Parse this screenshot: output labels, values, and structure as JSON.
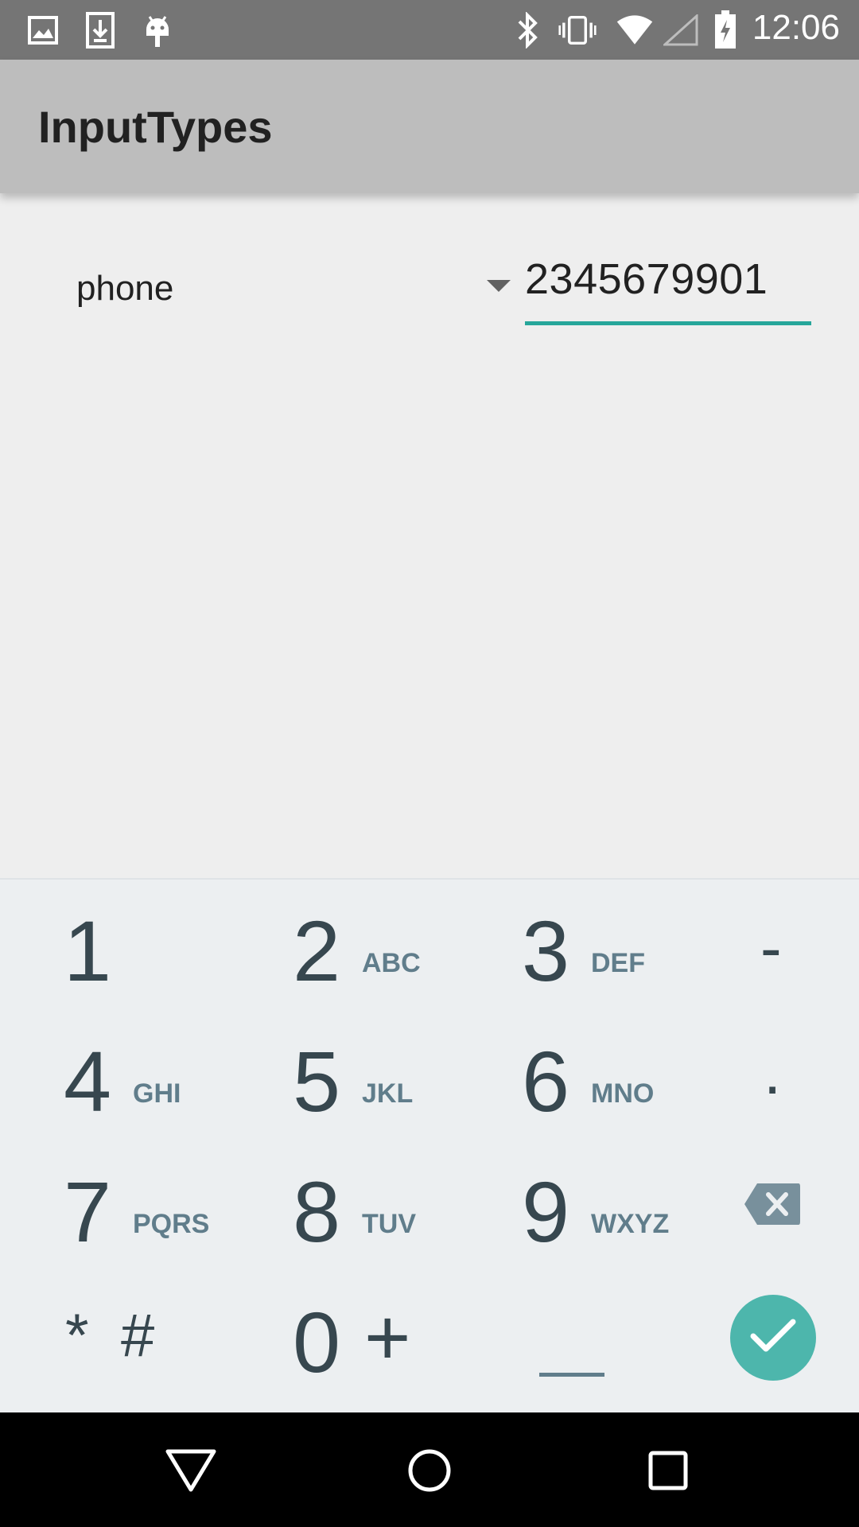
{
  "status_bar": {
    "time": "12:06",
    "icons": [
      "image-icon",
      "download-icon",
      "android-icon",
      "bluetooth-icon",
      "vibrate-icon",
      "wifi-icon",
      "signal-icon",
      "battery-charging-icon"
    ]
  },
  "app_bar": {
    "title": "InputTypes"
  },
  "form": {
    "spinner_value": "phone",
    "phone_value": "2345679901",
    "accent_color": "#26a69a"
  },
  "keypad": {
    "keys": [
      {
        "digit": "1",
        "letters": ""
      },
      {
        "digit": "2",
        "letters": "ABC"
      },
      {
        "digit": "3",
        "letters": "DEF"
      },
      {
        "digit": "-",
        "letters": ""
      },
      {
        "digit": "4",
        "letters": "GHI"
      },
      {
        "digit": "5",
        "letters": "JKL"
      },
      {
        "digit": "6",
        "letters": "MNO"
      },
      {
        "digit": ".",
        "letters": ""
      },
      {
        "digit": "7",
        "letters": "PQRS"
      },
      {
        "digit": "8",
        "letters": "TUV"
      },
      {
        "digit": "9",
        "letters": "WXYZ"
      },
      {
        "digit": "",
        "letters": ""
      },
      {
        "digit": "*",
        "letters": "#"
      },
      {
        "digit": "0",
        "letters": "+"
      },
      {
        "digit": "",
        "letters": ""
      },
      {
        "digit": "",
        "letters": ""
      }
    ],
    "backspace_icon": "backspace-icon",
    "enter_icon": "check-icon",
    "space_icon": "space-icon"
  },
  "nav_bar": {
    "icons": [
      "back-icon",
      "home-icon",
      "recents-icon"
    ]
  }
}
